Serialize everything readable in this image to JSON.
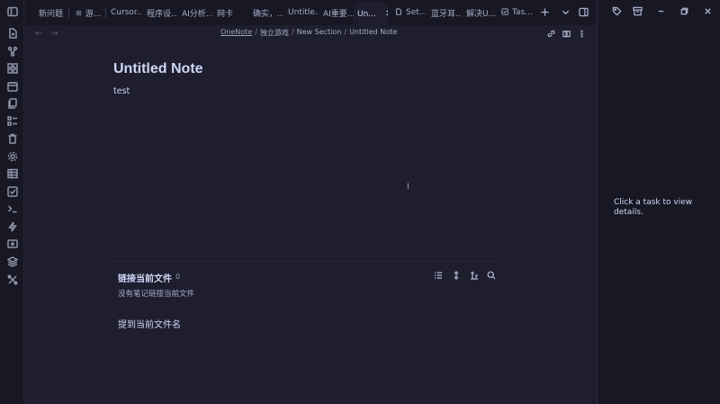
{
  "tabs": [
    {
      "label": "新问题",
      "icon": ""
    },
    {
      "label": "游...",
      "icon": "grid-icon"
    },
    {
      "label": "Cursor...",
      "icon": ""
    },
    {
      "label": "程序设...",
      "icon": ""
    },
    {
      "label": "AI分析...",
      "icon": ""
    },
    {
      "label": "网卡",
      "icon": ""
    },
    {
      "label": "确实，...",
      "icon": ""
    },
    {
      "label": "Untitle...",
      "icon": ""
    },
    {
      "label": "AI重要...",
      "icon": ""
    },
    {
      "label": "Un...",
      "icon": "",
      "active": true
    },
    {
      "label": "Set...",
      "icon": "file-icon"
    },
    {
      "label": "蓝牙耳...",
      "icon": ""
    },
    {
      "label": "解决U...",
      "icon": ""
    },
    {
      "label": "Tas...",
      "icon": "checkbox-icon"
    }
  ],
  "breadcrumb": {
    "root": "OneNote",
    "sep": "/",
    "parts": [
      "独立游戏",
      "New Section",
      "Untitled Note"
    ]
  },
  "note": {
    "title": "Untitled Note",
    "body": "test",
    "cursor": "I"
  },
  "backlinks": {
    "title": "链接当前文件",
    "count": "0",
    "empty": "没有笔记链接当前文件",
    "mentions_title": "提到当前文件名"
  },
  "right_pane": {
    "message": "Click a task to view details."
  },
  "ribbon_icons": [
    "new-note-icon",
    "graph-icon",
    "canvas-icon",
    "calendar-icon",
    "copy-icon",
    "bases-icon",
    "trash-icon",
    "settings-icon",
    "table-icon",
    "task-icon",
    "terminal-icon",
    "lightning-icon",
    "import-icon",
    "layers-icon",
    "tools-icon"
  ],
  "colors": {
    "bg": "#1e1e2e",
    "sidebar": "#181825",
    "text": "#cdd6f4",
    "muted": "#a6adc8"
  }
}
